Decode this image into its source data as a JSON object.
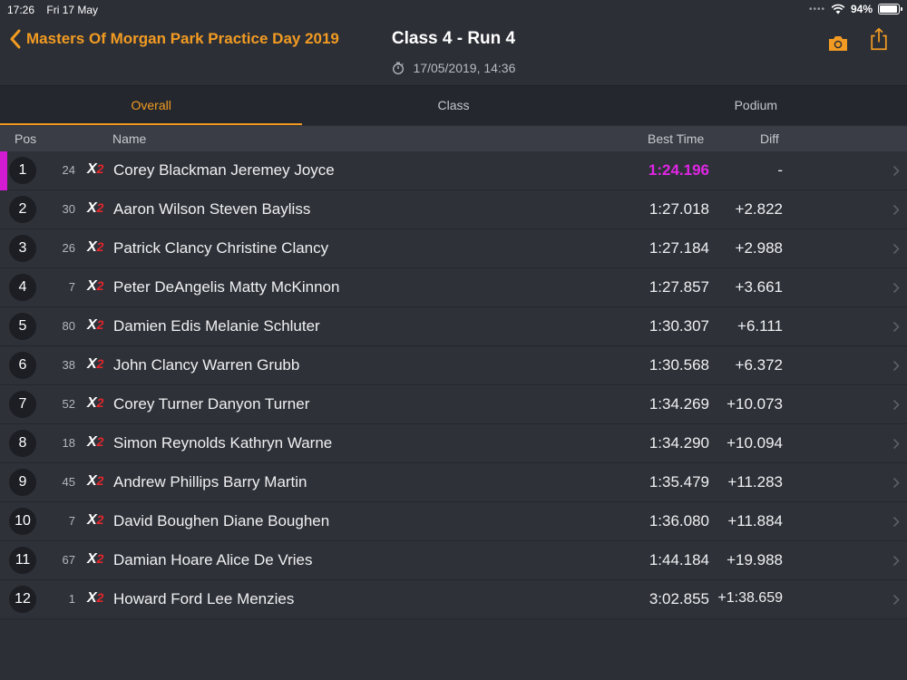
{
  "status": {
    "time": "17:26",
    "date": "Fri 17 May",
    "battery": "94%",
    "battery_level": 0.94
  },
  "nav": {
    "back_label": "Masters Of Morgan Park Practice Day 2019",
    "title": "Class 4 - Run 4",
    "subtitle": "17/05/2019, 14:36",
    "accent": "#f29b22"
  },
  "tabs": [
    {
      "label": "Overall",
      "active": true
    },
    {
      "label": "Class",
      "active": false
    },
    {
      "label": "Podium",
      "active": false
    }
  ],
  "columns": {
    "pos": "Pos",
    "name": "Name",
    "best_time": "Best Time",
    "diff": "Diff"
  },
  "rows": [
    {
      "pos": "1",
      "num": "24",
      "class_x": "X",
      "class_2": "2",
      "name": "Corey Blackman Jeremey Joyce",
      "best": "1:24.196",
      "diff": "-"
    },
    {
      "pos": "2",
      "num": "30",
      "class_x": "X",
      "class_2": "2",
      "name": "Aaron Wilson Steven Bayliss",
      "best": "1:27.018",
      "diff": "+2.822"
    },
    {
      "pos": "3",
      "num": "26",
      "class_x": "X",
      "class_2": "2",
      "name": "Patrick Clancy Christine Clancy",
      "best": "1:27.184",
      "diff": "+2.988"
    },
    {
      "pos": "4",
      "num": "7",
      "class_x": "X",
      "class_2": "2",
      "name": "Peter DeAngelis Matty McKinnon",
      "best": "1:27.857",
      "diff": "+3.661"
    },
    {
      "pos": "5",
      "num": "80",
      "class_x": "X",
      "class_2": "2",
      "name": "Damien Edis Melanie Schluter",
      "best": "1:30.307",
      "diff": "+6.111"
    },
    {
      "pos": "6",
      "num": "38",
      "class_x": "X",
      "class_2": "2",
      "name": "John Clancy Warren Grubb",
      "best": "1:30.568",
      "diff": "+6.372"
    },
    {
      "pos": "7",
      "num": "52",
      "class_x": "X",
      "class_2": "2",
      "name": "Corey Turner Danyon Turner",
      "best": "1:34.269",
      "diff": "+10.073"
    },
    {
      "pos": "8",
      "num": "18",
      "class_x": "X",
      "class_2": "2",
      "name": "Simon Reynolds Kathryn Warne",
      "best": "1:34.290",
      "diff": "+10.094"
    },
    {
      "pos": "9",
      "num": "45",
      "class_x": "X",
      "class_2": "2",
      "name": "Andrew Phillips Barry Martin",
      "best": "1:35.479",
      "diff": "+11.283"
    },
    {
      "pos": "10",
      "num": "7",
      "class_x": "X",
      "class_2": "2",
      "name": "David Boughen Diane Boughen",
      "best": "1:36.080",
      "diff": "+11.884"
    },
    {
      "pos": "11",
      "num": "67",
      "class_x": "X",
      "class_2": "2",
      "name": "Damian Hoare Alice De Vries",
      "best": "1:44.184",
      "diff": "+19.988"
    },
    {
      "pos": "12",
      "num": "1",
      "class_x": "X",
      "class_2": "2",
      "name": "Howard Ford Lee Menzies",
      "best": "3:02.855",
      "diff": "+1:38.659"
    }
  ],
  "colors": {
    "fastest": "#e026e5",
    "leader_marker": "#d21bd3",
    "class_red": "#e2262b"
  },
  "icons": {
    "back": "chevron-left-icon",
    "camera": "camera-icon",
    "share": "share-icon",
    "stopwatch": "stopwatch-icon",
    "row": "chevron-right-icon"
  }
}
